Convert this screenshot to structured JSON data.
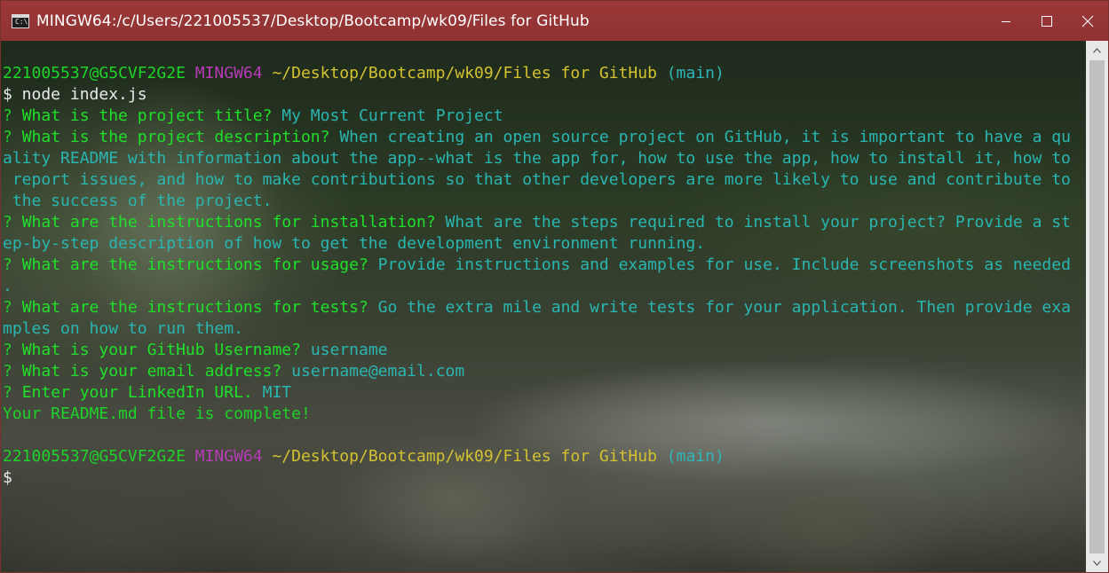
{
  "window": {
    "title": "MINGW64:/c/Users/221005537/Desktop/Bootcamp/wk09/Files for GitHub",
    "app_icon_glyph": "C:\\"
  },
  "colors": {
    "titlebar": "#9c3838",
    "prompt_user": "#1fd32a",
    "prompt_mingw": "#b83ab8",
    "prompt_path": "#d3c230",
    "prompt_branch": "#30b5b8",
    "answer": "#2ab6b0"
  },
  "terminal": {
    "prompt1": {
      "user_host": "221005537@G5CVF2G2E",
      "system": "MINGW64",
      "path": "~/Desktop/Bootcamp/wk09/Files for GitHub",
      "branch": "(main)"
    },
    "command": "$ node index.js",
    "qa": [
      {
        "mark": "?",
        "question": "What is the project title?",
        "answer_lines": [
          "My Most Current Project"
        ]
      },
      {
        "mark": "?",
        "question": "What is the project description?",
        "answer_lines": [
          "When creating an open source project on GitHub, it is important to have a qu",
          "ality README with information about the app--what is the app for, how to use the app, how to install it, how to",
          " report issues, and how to make contributions so that other developers are more likely to use and contribute to",
          " the success of the project."
        ]
      },
      {
        "mark": "?",
        "question": "What are the instructions for installation?",
        "answer_lines": [
          "What are the steps required to install your project? Provide a st",
          "ep-by-step description of how to get the development environment running."
        ]
      },
      {
        "mark": "?",
        "question": "What are the instructions for usage?",
        "answer_lines": [
          "Provide instructions and examples for use. Include screenshots as needed",
          "."
        ]
      },
      {
        "mark": "?",
        "question": "What are the instructions for tests?",
        "answer_lines": [
          "Go the extra mile and write tests for your application. Then provide exa",
          "mples on how to run them."
        ]
      },
      {
        "mark": "?",
        "question": "What is your GitHub Username?",
        "answer_lines": [
          "username"
        ]
      },
      {
        "mark": "?",
        "question": "What is your email address?",
        "answer_lines": [
          "username@email.com"
        ]
      },
      {
        "mark": "?",
        "question": "Enter your LinkedIn URL.",
        "answer_lines": [
          "MIT"
        ]
      }
    ],
    "complete_message": "Your README.md file is complete!",
    "prompt2": {
      "user_host": "221005537@G5CVF2G2E",
      "system": "MINGW64",
      "path": "~/Desktop/Bootcamp/wk09/Files for GitHub",
      "branch": "(main)"
    },
    "cursor_prompt": "$"
  },
  "icons": {
    "minimize": "minimize-icon",
    "maximize": "maximize-icon",
    "close": "close-icon",
    "scroll_up": "scroll-up-arrow-icon",
    "scroll_down": "scroll-down-arrow-icon"
  }
}
